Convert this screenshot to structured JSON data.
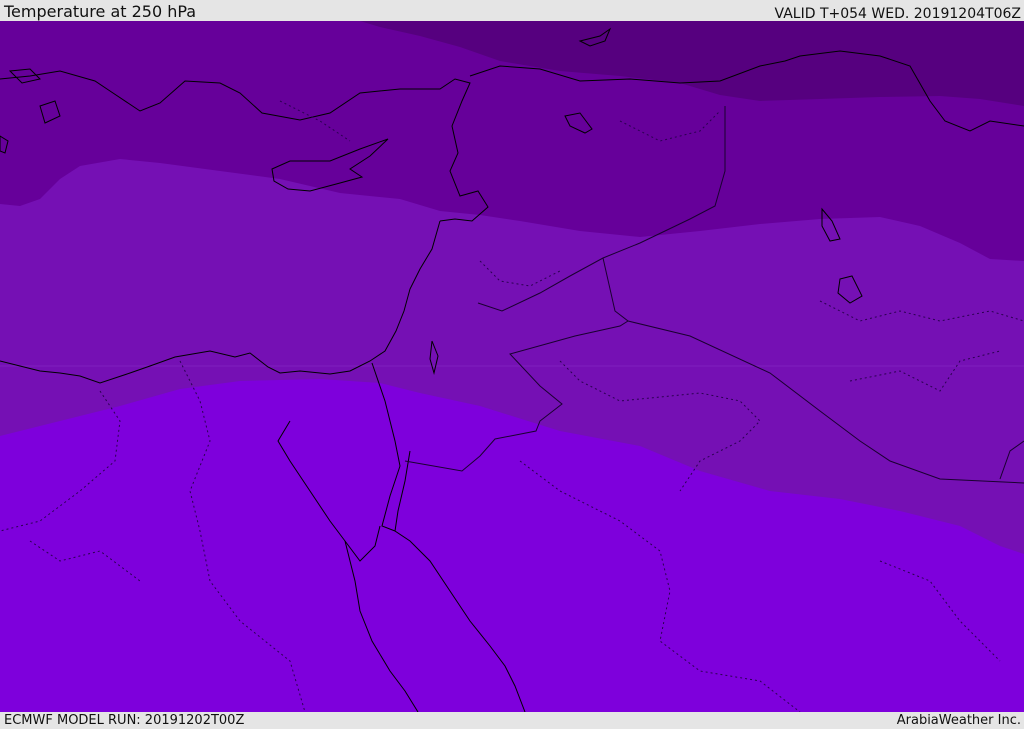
{
  "header": {
    "title": "Temperature at 250 hPa",
    "valid": "VALID T+054 WED. 20191204T06Z"
  },
  "footer": {
    "model_run": "ECMWF MODEL RUN: 20191202T00Z",
    "brand": "ArabiaWeather Inc."
  },
  "map": {
    "colors": {
      "band_coldest": "#56007f",
      "band_cold": "#66009a",
      "band_mid": "#7510b4",
      "band_warm": "#7e00dc",
      "coastline": "#000000",
      "border": "#1a0030"
    }
  }
}
